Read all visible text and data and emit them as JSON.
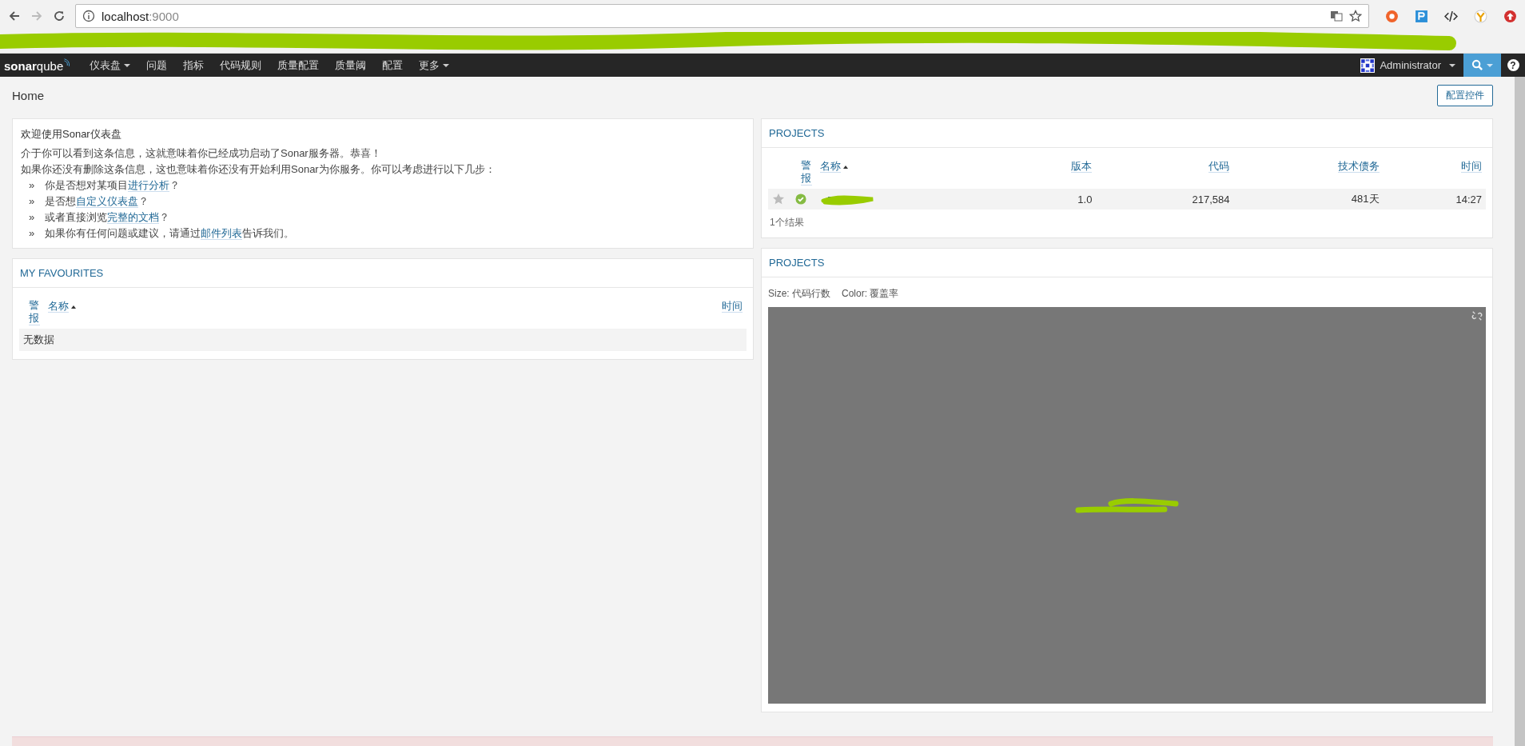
{
  "browser": {
    "url_host": "localhost",
    "url_port": ":9000"
  },
  "nav": {
    "logo_main": "sonar",
    "logo_accent": "qube",
    "items": [
      {
        "label": "仪表盘",
        "dropdown": true
      },
      {
        "label": "问题",
        "dropdown": false
      },
      {
        "label": "指标",
        "dropdown": false
      },
      {
        "label": "代码规则",
        "dropdown": false
      },
      {
        "label": "质量配置",
        "dropdown": false
      },
      {
        "label": "质量阈",
        "dropdown": false
      },
      {
        "label": "配置",
        "dropdown": false
      },
      {
        "label": "更多",
        "dropdown": true
      }
    ],
    "user": "Administrator",
    "help": "?"
  },
  "breadcrumb": "Home",
  "configure_button": "配置控件",
  "welcome": {
    "title": "欢迎使用Sonar仪表盘",
    "lines": [
      "介于你可以看到这条信息，这就意味着你已经成功启动了Sonar服务器。恭喜！",
      "如果你还没有删除这条信息，这也意味着你还没有开始利用Sonar为你服务。你可以考虑进行以下几步："
    ],
    "bullet": "»",
    "steps": [
      {
        "before": "你是否想对某项目",
        "link": "进行分析",
        "after": "？"
      },
      {
        "before": "是否想",
        "link": "自定义仪表盘",
        "after": "？"
      },
      {
        "before": "或者直接浏览",
        "link": "完整的文档",
        "after": "？"
      },
      {
        "before": "如果你有任何问题或建议，请通过",
        "link": "邮件列表",
        "after": "告诉我们。"
      }
    ]
  },
  "favourites": {
    "title": "MY FAVOURITES",
    "columns": [
      {
        "label": "警报",
        "sorted": false
      },
      {
        "label": "名称",
        "sorted": true
      },
      {
        "label": "时间",
        "sorted": false
      }
    ],
    "empty": "无数据"
  },
  "projects": {
    "title": "PROJECTS",
    "columns": [
      {
        "label": "警报",
        "sorted": false
      },
      {
        "label": "名称",
        "sorted": true
      },
      {
        "label": "版本",
        "sorted": false
      },
      {
        "label": "代码",
        "sorted": false
      },
      {
        "label": "技术债务",
        "sorted": false
      },
      {
        "label": "时间",
        "sorted": false
      }
    ],
    "rows": [
      {
        "favorite": false,
        "passed": true,
        "version": "1.0",
        "code": "217,584",
        "debt": "481天",
        "time": "14:27"
      }
    ],
    "count": "1个结果"
  },
  "treemap": {
    "title": "PROJECTS",
    "size_label": "Size:",
    "size_metric": "代码行数",
    "color_label": "Color:",
    "color_metric": "覆盖率"
  }
}
